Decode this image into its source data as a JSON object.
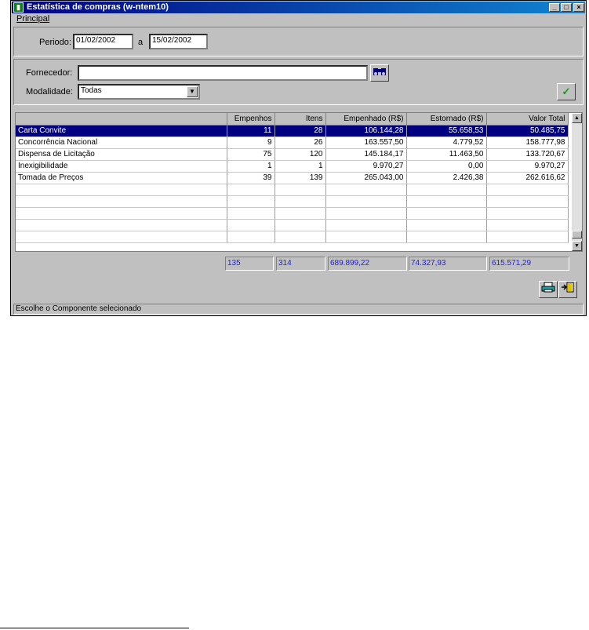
{
  "window": {
    "title": "Estatística de compras (w-ntem10)",
    "min_glyph": "_",
    "max_glyph": "□",
    "close_glyph": "×"
  },
  "menu": {
    "principal": "Principal"
  },
  "period": {
    "label": "Periodo:",
    "start": "01/02/2002",
    "sep": "a",
    "end": "15/02/2002"
  },
  "filters": {
    "fornecedor_label": "Fornecedor:",
    "fornecedor_value": "",
    "modalidade_label": "Modalidade:",
    "modalidade_value": "Todas"
  },
  "grid": {
    "columns": [
      "",
      "Empenhos",
      "Itens",
      "Empenhado (R$)",
      "Estornado (R$)",
      "Valor Total"
    ],
    "rows": [
      [
        "Carta Convite",
        "11",
        "28",
        "106.144,28",
        "55.658,53",
        "50.485,75"
      ],
      [
        "Concorrência Nacional",
        "9",
        "26",
        "163.557,50",
        "4.779,52",
        "158.777,98"
      ],
      [
        "Dispensa de Licitação",
        "75",
        "120",
        "145.184,17",
        "11.463,50",
        "133.720,67"
      ],
      [
        "Inexigibilidade",
        "1",
        "1",
        "9.970,27",
        "0,00",
        "9.970,27"
      ],
      [
        "Tomada de Preços",
        "39",
        "139",
        "265.043,00",
        "2.426,38",
        "262.616,62"
      ]
    ],
    "selected_row": 0,
    "empty_rows": 5
  },
  "totals": [
    "135",
    "314",
    "689.899,22",
    "74.327,93",
    "615.571,29"
  ],
  "status": "Escolhe o Componente selecionado",
  "colors": {
    "title_start": "#000080",
    "title_end": "#1084d0",
    "selection": "#000080",
    "totals_text": "#2020e0"
  }
}
